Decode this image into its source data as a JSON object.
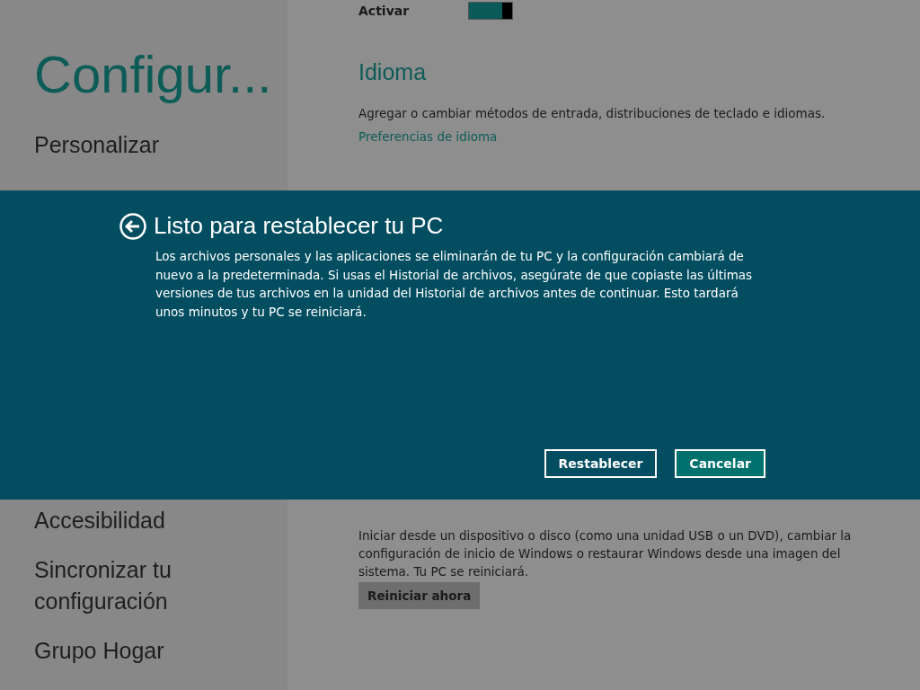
{
  "sidebar": {
    "title": "Configur...",
    "nav_items_top": [
      {
        "label": "Personalizar"
      }
    ],
    "nav_items_bottom": [
      {
        "label": "Accesibilidad"
      },
      {
        "label": "Sincronizar tu configuración"
      },
      {
        "label": "Grupo Hogar"
      }
    ]
  },
  "content": {
    "toggle": {
      "label": "Activar",
      "on": true
    },
    "language": {
      "heading": "Idioma",
      "description": "Agregar o cambiar métodos de entrada, distribuciones de teclado e idiomas.",
      "link": "Preferencias de idioma"
    },
    "advanced_start": {
      "description": "Iniciar desde un dispositivo o disco (como una unidad USB o un DVD), cambiar la configuración de inicio de Windows o restaurar Windows desde una imagen del sistema. Tu PC se reiniciará.",
      "button": "Reiniciar ahora"
    }
  },
  "dialog": {
    "title": "Listo para restablecer tu PC",
    "message": "Los archivos personales y las aplicaciones se eliminarán de tu PC y la configuración cambiará de nuevo a la predeterminada. Si usas el Historial de archivos, asegúrate de que copiaste las últimas versiones de tus archivos en la unidad del Historial de archivos antes de continuar. Esto tardará unos minutos y tu PC se reiniciará.",
    "buttons": [
      {
        "label": "Restablecer",
        "kind": "outline"
      },
      {
        "label": "Cancelar",
        "kind": "filled"
      }
    ]
  }
}
